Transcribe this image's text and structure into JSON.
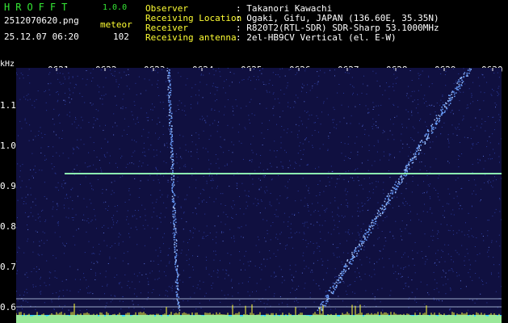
{
  "app": {
    "logo": "HROFFT",
    "version": "1.0.0",
    "filename": "2512070620.png",
    "meteor_label": "meteor",
    "timestamp": "25.12.07 06:20",
    "meteor_count": "102"
  },
  "info": [
    {
      "label": "Observer",
      "value": ": Takanori Kawachi"
    },
    {
      "label": "Receiving Location",
      "value": ": Ogaki, Gifu, JAPAN (136.60E, 35.35N)"
    },
    {
      "label": "Receiver",
      "value": ": R820T2(RTL-SDR) SDR-Sharp 53.1000MHz"
    },
    {
      "label": "Receiving antenna",
      "value": ": 2el-HB9CV Vertical (el. E-W)"
    }
  ],
  "axis": {
    "unit": "kHz",
    "time_labels": [
      "0621",
      "0622",
      "0623",
      "0624",
      "0625",
      "0626",
      "0627",
      "0628",
      "0629",
      "0630"
    ],
    "freq_labels": [
      "1.1",
      "1.0",
      "0.9",
      "0.8",
      "0.7",
      "0.6"
    ]
  },
  "colors": {
    "background": "#101040",
    "noise": "#2a3a9a",
    "trace": "#6aa0ff",
    "carrier": "#8cf0b0",
    "baseline": "#ffff33",
    "floor": "#33d0ff"
  }
}
